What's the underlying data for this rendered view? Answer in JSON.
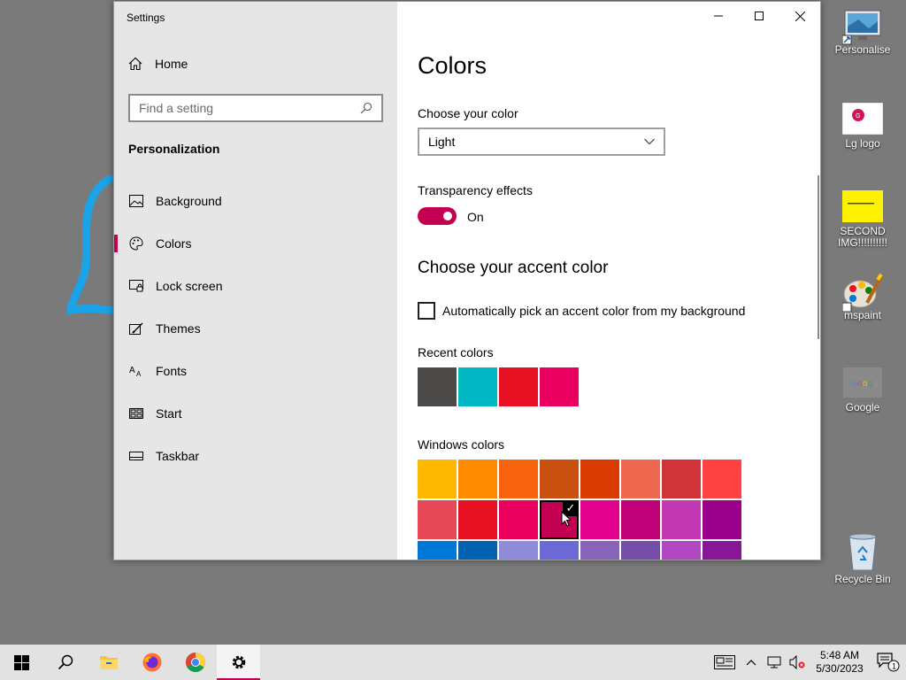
{
  "window": {
    "title": "Settings",
    "home_label": "Home",
    "search_placeholder": "Find a setting",
    "section_label": "Personalization",
    "nav_items": [
      {
        "label": "Background",
        "icon": "image-icon"
      },
      {
        "label": "Colors",
        "icon": "palette-icon",
        "active": true
      },
      {
        "label": "Lock screen",
        "icon": "lock-screen-icon"
      },
      {
        "label": "Themes",
        "icon": "themes-icon"
      },
      {
        "label": "Fonts",
        "icon": "fonts-icon"
      },
      {
        "label": "Start",
        "icon": "start-icon"
      },
      {
        "label": "Taskbar",
        "icon": "taskbar-icon"
      }
    ]
  },
  "content": {
    "page_title": "Colors",
    "choose_color_label": "Choose your color",
    "choose_color_value": "Light",
    "transparency_label": "Transparency effects",
    "transparency_state": "On",
    "accent_heading": "Choose your accent color",
    "auto_pick_label": "Automatically pick an accent color from my background",
    "auto_pick_checked": false,
    "recent_colors_label": "Recent colors",
    "recent_colors": [
      "#4c4a48",
      "#00b7c3",
      "#e81123",
      "#ea005e"
    ],
    "windows_colors_label": "Windows colors",
    "windows_colors": [
      "#ffb900",
      "#ff8c00",
      "#f7630c",
      "#ca5010",
      "#da3b01",
      "#ef6950",
      "#d13438",
      "#ff4343",
      "#e74856",
      "#e81123",
      "#ea005e",
      "#c30052",
      "#e3008c",
      "#bf0077",
      "#c239b3",
      "#9a0089",
      "#0078d7",
      "#0063b1",
      "#8e8cd8",
      "#6b69d6",
      "#8764b8",
      "#744da9",
      "#b146c2",
      "#881798"
    ],
    "selected_color_index": 11,
    "accent_color": "#c30052"
  },
  "desktop": {
    "icons": [
      {
        "label": "Personalise",
        "icon": "monitor-icon"
      },
      {
        "label": "Lg logo",
        "icon": "lg-logo-icon"
      },
      {
        "label": "SECOND IMG!!!!!!!!!!",
        "icon": "yellow-image-icon"
      },
      {
        "label": "mspaint",
        "icon": "mspaint-icon"
      },
      {
        "label": "Google",
        "icon": "google-icon"
      },
      {
        "label": "Recycle Bin",
        "icon": "recycle-bin-icon"
      }
    ]
  },
  "taskbar": {
    "time": "5:48 AM",
    "date": "5/30/2023",
    "notification_count": "1"
  }
}
